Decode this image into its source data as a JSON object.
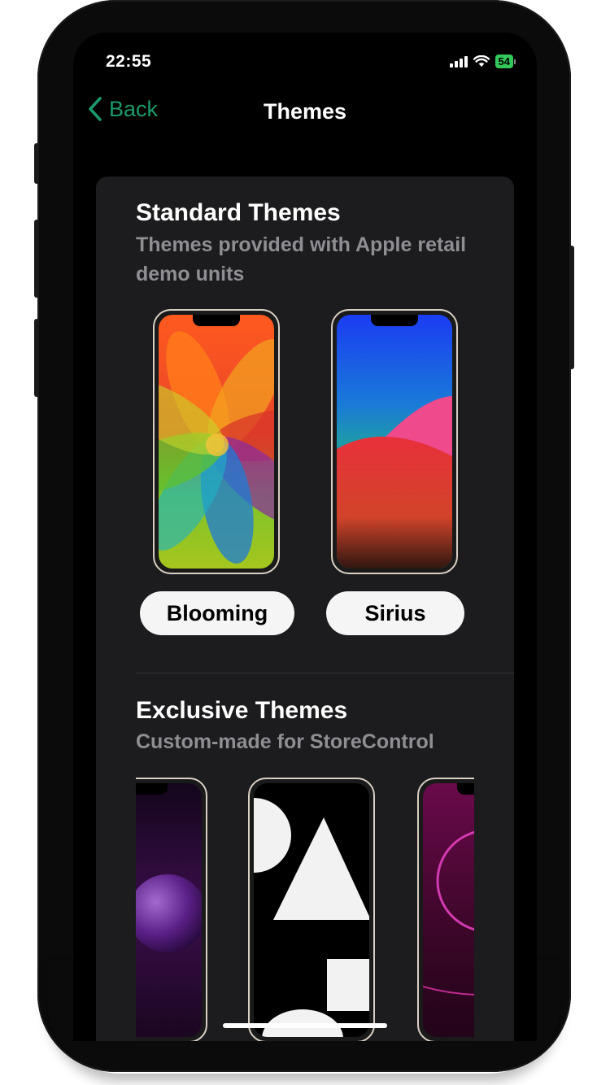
{
  "status_bar": {
    "time": "22:55",
    "battery": "54"
  },
  "nav": {
    "back_label": "Back",
    "title": "Themes"
  },
  "standard": {
    "title": "Standard Themes",
    "subtitle": "Themes provided with Apple retail demo units",
    "themes": [
      {
        "label": "Blooming",
        "icon": "blooming-wallpaper"
      },
      {
        "label": "Sirius",
        "icon": "sirius-wallpaper"
      }
    ]
  },
  "exclusive": {
    "title": "Exclusive Themes",
    "subtitle": "Custom-made for StoreControl",
    "themes": [
      {
        "icon": "purple-sphere-wallpaper"
      },
      {
        "icon": "geometric-shapes-wallpaper"
      },
      {
        "icon": "magenta-rings-wallpaper"
      }
    ]
  },
  "colors": {
    "accent": "#1a9a6b",
    "card": "#1c1c1e",
    "background": "#000000",
    "subtitle": "#8e8e93"
  }
}
